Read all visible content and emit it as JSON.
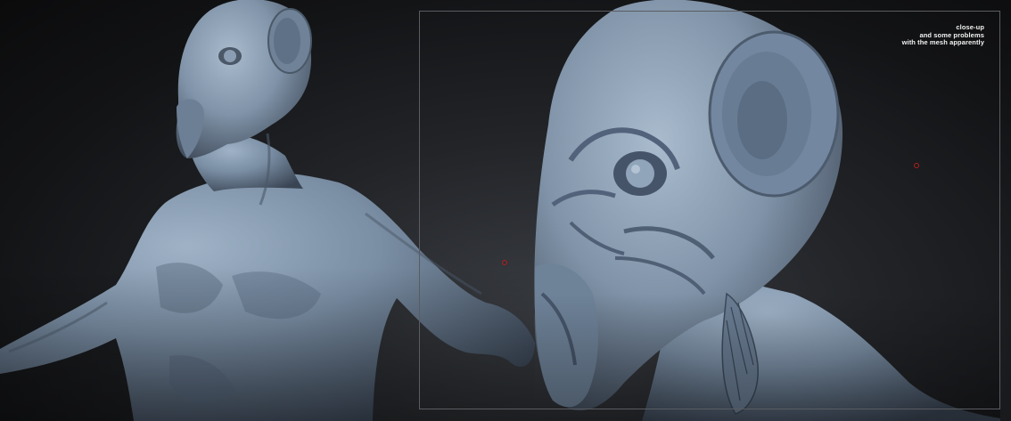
{
  "note": {
    "lines": [
      "close-up",
      "and some problems",
      "with the mesh apparently"
    ]
  },
  "colors": {
    "background": "#1a1b1d",
    "clay": "#7a8da3",
    "frame": "#5a5c61",
    "marker": "#b11f1f",
    "text": "#f2f2f2"
  }
}
